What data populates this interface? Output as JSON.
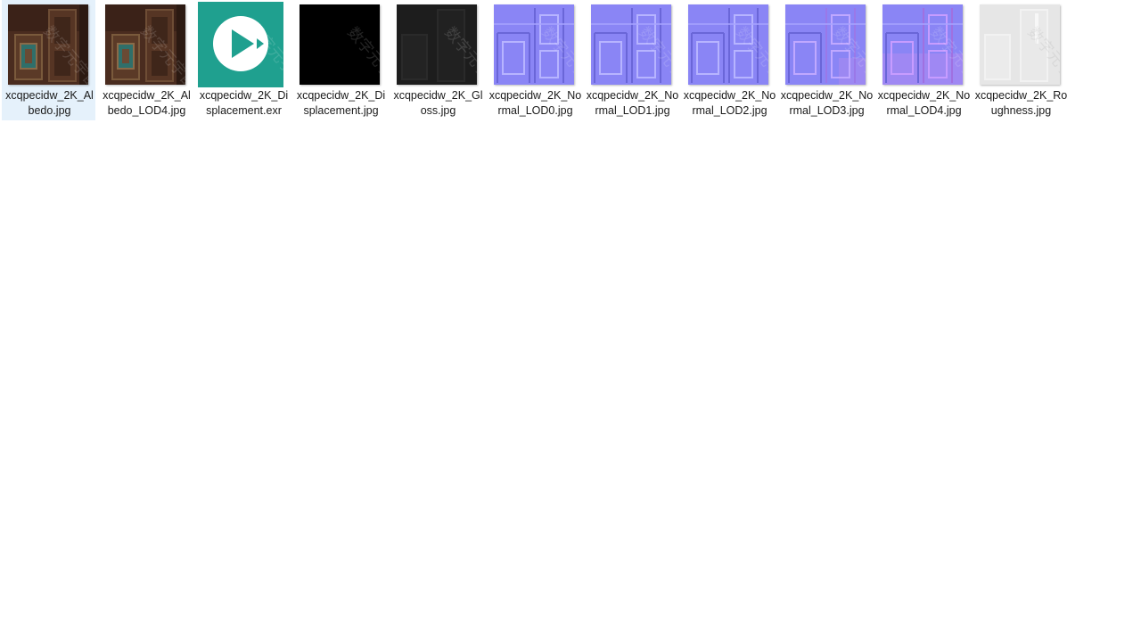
{
  "files": [
    {
      "name": "xcqpecidw_2K_Albedo.jpg",
      "icon": "albedo-texture",
      "selected": true,
      "colors": {
        "base": "#4a2c1f",
        "detail": "#7a5a3c",
        "accent": "#2f6f6a"
      }
    },
    {
      "name": "xcqpecidw_2K_Albedo_LOD4.jpg",
      "icon": "albedo-texture",
      "selected": false,
      "colors": {
        "base": "#4a2c1f",
        "detail": "#7a5a3c",
        "accent": "#2f6f6a"
      }
    },
    {
      "name": "xcqpecidw_2K_Displacement.exr",
      "icon": "media-player-icon",
      "selected": false,
      "colors": {
        "base": "#1fa08f",
        "glyph": "#ffffff"
      }
    },
    {
      "name": "xcqpecidw_2K_Displacement.jpg",
      "icon": "displacement-texture",
      "selected": false,
      "colors": {
        "base": "#000000"
      }
    },
    {
      "name": "xcqpecidw_2K_Gloss.jpg",
      "icon": "gloss-texture",
      "selected": false,
      "colors": {
        "base": "#1d1d1d",
        "detail": "#2a2a2a"
      }
    },
    {
      "name": "xcqpecidw_2K_Normal_LOD0.jpg",
      "icon": "normal-texture",
      "selected": false,
      "colors": {
        "base": "#8a85f5",
        "detail": "#b7b4ff",
        "accent": "#6a66d8"
      }
    },
    {
      "name": "xcqpecidw_2K_Normal_LOD1.jpg",
      "icon": "normal-texture",
      "selected": false,
      "colors": {
        "base": "#8a85f5",
        "detail": "#b7b4ff",
        "accent": "#6a66d8"
      }
    },
    {
      "name": "xcqpecidw_2K_Normal_LOD2.jpg",
      "icon": "normal-texture",
      "selected": false,
      "colors": {
        "base": "#8a85f5",
        "detail": "#b7b4ff",
        "accent": "#6a66d8"
      }
    },
    {
      "name": "xcqpecidw_2K_Normal_LOD3.jpg",
      "icon": "normal-texture",
      "selected": false,
      "colors": {
        "base": "#8a85f5",
        "detail": "#c0a8ff",
        "accent": "#9a78e8"
      }
    },
    {
      "name": "xcqpecidw_2K_Normal_LOD4.jpg",
      "icon": "normal-texture",
      "selected": false,
      "colors": {
        "base": "#8a85f5",
        "detail": "#c79cff",
        "accent": "#a070e0"
      }
    },
    {
      "name": "xcqpecidw_2K_Roughness.jpg",
      "icon": "roughness-texture",
      "selected": false,
      "colors": {
        "base": "#e6e6e6",
        "detail": "#f2f2f2"
      }
    }
  ],
  "watermark": "数字元宇宙"
}
